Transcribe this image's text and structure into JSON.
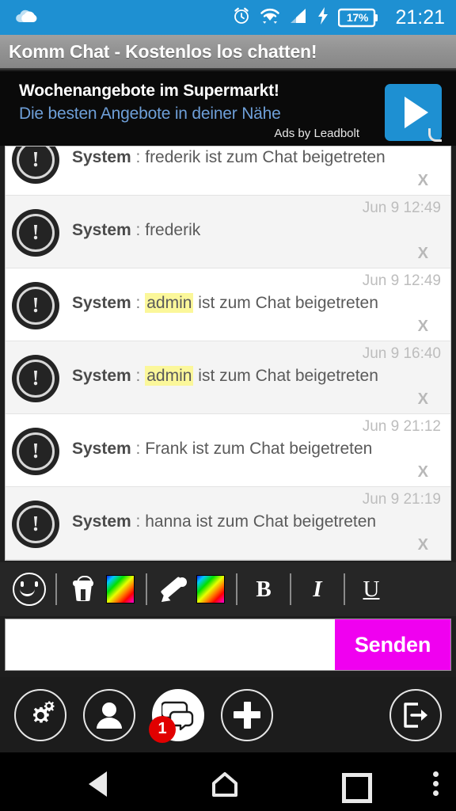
{
  "statusbar": {
    "left_icon": "cloud-icon",
    "icons": [
      "alarm-icon",
      "wifi-icon",
      "signal-icon",
      "charging-bolt-icon"
    ],
    "battery_percent": "17%",
    "clock": "21:21",
    "background_color": "#1e90d2"
  },
  "titlebar": {
    "title": "Komm Chat - Kostenlos los chatten!"
  },
  "ad": {
    "headline": "Wochenangebote im Supermarkt!",
    "subline": "Die besten Angebote in deiner Nähe",
    "attribution": "Ads by Leadbolt",
    "cta_icon": "play-triangle-icon",
    "cta_color": "#1e90d2"
  },
  "chat": {
    "close_label": "X",
    "messages": [
      {
        "avatar_icon": "system-alert-avatar",
        "time": "",
        "sender": "System",
        "separator": ":",
        "highlight": "",
        "text": "frederik ist zum Chat beigetreten",
        "clipped": true
      },
      {
        "avatar_icon": "system-alert-avatar",
        "time": "Jun 9 12:49",
        "sender": "System",
        "separator": ":",
        "highlight": "",
        "text": "frederik"
      },
      {
        "avatar_icon": "system-alert-avatar",
        "time": "Jun 9 12:49",
        "sender": "System",
        "separator": ":",
        "highlight": "admin",
        "text": "ist zum Chat beigetreten"
      },
      {
        "avatar_icon": "system-alert-avatar",
        "time": "Jun 9 16:40",
        "sender": "System",
        "separator": ":",
        "highlight": "admin",
        "text": "ist zum Chat beigetreten"
      },
      {
        "avatar_icon": "system-alert-avatar",
        "time": "Jun 9 21:12",
        "sender": "System",
        "separator": ":",
        "highlight": "",
        "text": "Frank ist zum Chat beigetreten"
      },
      {
        "avatar_icon": "system-alert-avatar",
        "time": "Jun 9 21:19",
        "sender": "System",
        "separator": ":",
        "highlight": "",
        "text": "hanna ist zum Chat beigetreten"
      }
    ],
    "highlight_color": "#fbf79a"
  },
  "formatbar": {
    "items": [
      {
        "name": "emoji-icon",
        "label": ""
      },
      {
        "name": "fill-bucket-icon",
        "label": ""
      },
      {
        "name": "background-color-swatch",
        "label": ""
      },
      {
        "name": "pencil-icon",
        "label": ""
      },
      {
        "name": "text-color-swatch",
        "label": ""
      },
      {
        "name": "bold-button",
        "label": "B"
      },
      {
        "name": "italic-button",
        "label": "I"
      },
      {
        "name": "underline-button",
        "label": "U"
      }
    ]
  },
  "composer": {
    "value": "",
    "placeholder": "",
    "send_label": "Senden",
    "send_color": "#f000f0"
  },
  "actionbar": {
    "buttons": [
      {
        "name": "settings-gears-icon",
        "badge": ""
      },
      {
        "name": "profile-user-icon",
        "badge": ""
      },
      {
        "name": "chat-bubble-icon",
        "badge": "1"
      },
      {
        "name": "add-plus-icon",
        "badge": ""
      },
      {
        "name": "logout-exit-icon",
        "badge": ""
      }
    ],
    "badge_color": "#e10000"
  },
  "navbar": {
    "buttons": [
      "back-icon",
      "home-icon",
      "recents-icon",
      "overflow-menu-icon"
    ]
  }
}
